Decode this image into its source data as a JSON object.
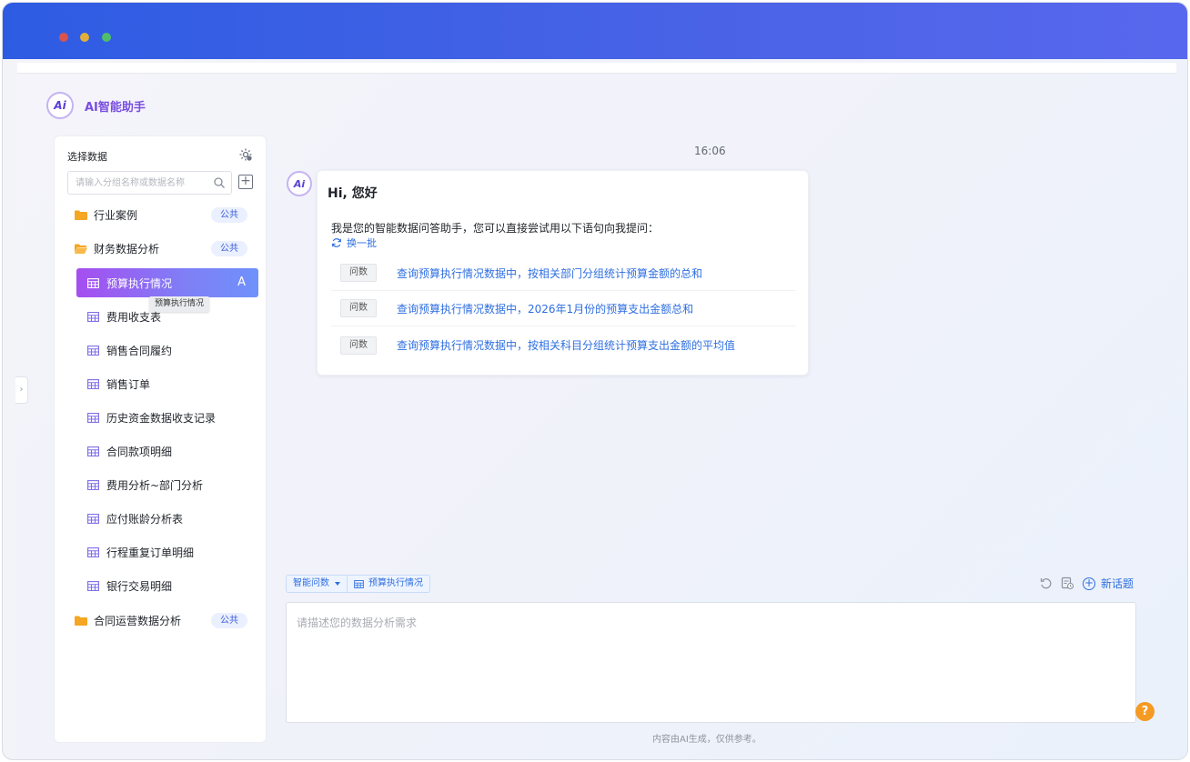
{
  "window": {
    "traffic_lights": [
      "close",
      "minimize",
      "maximize"
    ]
  },
  "brand": {
    "logo_text": "Ai",
    "title": "AI智能助手"
  },
  "sidebar": {
    "heading": "选择数据",
    "search_placeholder": "请输入分组名称或数据名称",
    "groups": [
      {
        "label": "行业案例",
        "badge": "公共",
        "expanded": false
      },
      {
        "label": "财务数据分析",
        "badge": "公共",
        "expanded": true
      },
      {
        "label": "合同运营数据分析",
        "badge": "公共",
        "expanded": false
      }
    ],
    "items": [
      {
        "label": "预算执行情况",
        "active": true,
        "action_icon": "A"
      },
      {
        "label": "费用收支表"
      },
      {
        "label": "销售合同履约"
      },
      {
        "label": "销售订单"
      },
      {
        "label": "历史资金数据收支记录"
      },
      {
        "label": "合同款项明细"
      },
      {
        "label": "费用分析~部门分析"
      },
      {
        "label": "应付账龄分析表"
      },
      {
        "label": "行程重复订单明细"
      },
      {
        "label": "银行交易明细"
      }
    ],
    "tooltip": "预算执行情况"
  },
  "chat": {
    "time": "16:06",
    "bot_avatar_text": "Ai",
    "greeting": "Hi, 您好",
    "intro": "我是您的智能数据问答助手，您可以直接尝试用以下语句向我提问：",
    "refresh_label": "换一批",
    "questions": [
      {
        "tag": "问数",
        "text": "查询预算执行情况数据中，按相关部门分组统计预算金额的总和"
      },
      {
        "tag": "问数",
        "text": "查询预算执行情况数据中，2026年1月份的预算支出金额总和"
      },
      {
        "tag": "问数",
        "text": "查询预算执行情况数据中，按相关科目分组统计预算支出金额的平均值"
      }
    ]
  },
  "composer": {
    "mode_label": "智能问数",
    "dataset_label": "预算执行情况",
    "new_topic_label": "新话题",
    "placeholder": "请描述您的数据分析需求",
    "disclaimer": "内容由AI生成，仅供参考。",
    "help_label": "?"
  },
  "colors": {
    "titlebar": "#3a5fe5",
    "accent": "#2f6fe0",
    "active_gradient_start": "#a54ef0",
    "active_gradient_end": "#6f91fb",
    "help": "#f59a23"
  }
}
